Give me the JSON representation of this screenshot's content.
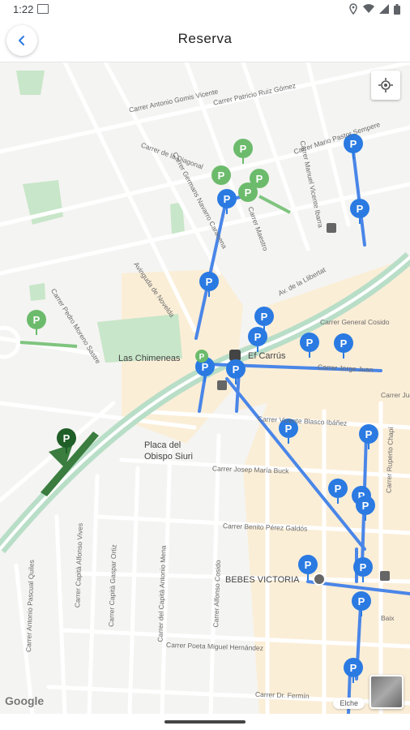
{
  "status": {
    "time": "1:22"
  },
  "header": {
    "title": "Reserva"
  },
  "map": {
    "streets": [
      "Carrer Antonio Gomis Vicente",
      "Carrer Patricio Ruiz Gómez",
      "Carrer Mario Pastor Sempere",
      "Carrer de la Diagonal",
      "Carrer Germans Navarro Caracena",
      "Carrer Manuel Vicente Ibarra",
      "Carrer Maestro",
      "Avinguda de Novelda",
      "Av. de la Llibertat",
      "Carrer Pedro Moreno Sastre",
      "Carrer General Cosido",
      "Carrer Jorge Juan",
      "Carrer Vicente Blasco Ibáñez",
      "Carrer Josep María Buck",
      "Carrer Benito Pérez Galdós",
      "Carrer Ruperto Chapí",
      "Carrer Capità Alfonso Vives",
      "Carrer Capità Gaspar Ortiz",
      "Carrer del Capità Antonio Mena",
      "Carrer Alfonso Cosido",
      "Carrer Poeta Miguel Hernández",
      "Carrer Dr. Fermín",
      "Carrer Antonio Pascual Quiles",
      "Carrer Juan",
      "Baix"
    ],
    "places": {
      "chimeneas": "Las Chimeneas",
      "carrus": "Ef Carrús",
      "placa": "Placa del Obispo Siuri",
      "bebes": "BEBES VICTORIA"
    },
    "google": "Google",
    "city": "Elche"
  },
  "colors": {
    "accent": "#2a7ae2",
    "parking_green": "#6cbb6c",
    "parking_dark": "#2e6a35",
    "route": "#4a86e8"
  },
  "icons": {
    "back": "arrow-left-icon",
    "locate": "crosshair-icon",
    "parking": "parking-pin-icon"
  }
}
